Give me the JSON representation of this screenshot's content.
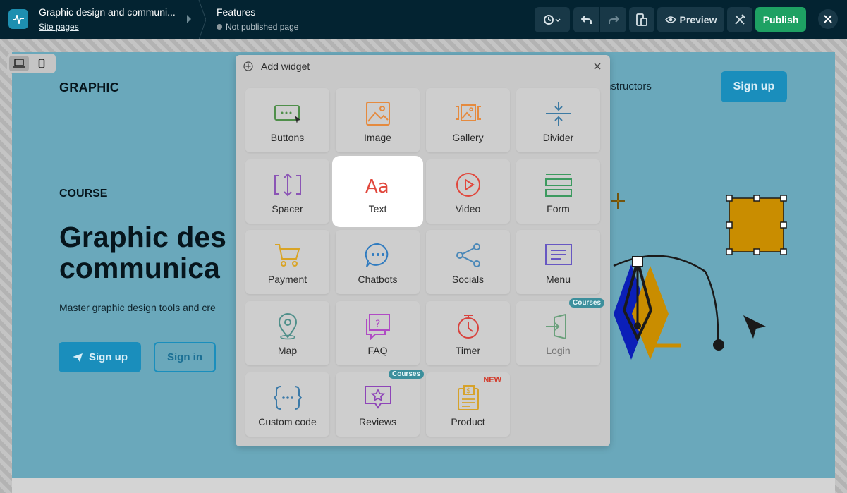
{
  "topbar": {
    "site_title": "Graphic design and communi...",
    "site_pages_link": "Site pages",
    "page_name": "Features",
    "page_status": "Not published page",
    "preview_label": "Preview",
    "publish_label": "Publish"
  },
  "site": {
    "logo_text": "GRAPHIC",
    "nav_item": "nstructors",
    "signup_top_label": "Sign up",
    "course_label": "COURSE",
    "hero_title": "Graphic des\ncommunica",
    "hero_desc": "Master graphic design tools and cre",
    "signup_label": "Sign up",
    "signin_label": "Sign in"
  },
  "panel": {
    "title": "Add widget",
    "tiles": [
      {
        "label": "Buttons",
        "icon": "buttons-icon",
        "color": "#4f8f4a"
      },
      {
        "label": "Image",
        "icon": "image-icon",
        "color": "#e58a3e"
      },
      {
        "label": "Gallery",
        "icon": "gallery-icon",
        "color": "#e58a3e"
      },
      {
        "label": "Divider",
        "icon": "divider-icon",
        "color": "#3d7aa3"
      },
      {
        "label": "Spacer",
        "icon": "spacer-icon",
        "color": "#8b55b5"
      },
      {
        "label": "Text",
        "icon": "text-icon",
        "color": "#e1473c"
      },
      {
        "label": "Video",
        "icon": "video-icon",
        "color": "#e1473c"
      },
      {
        "label": "Form",
        "icon": "form-icon",
        "color": "#3c9a5f"
      },
      {
        "label": "Payment",
        "icon": "cart-icon",
        "color": "#d9a425"
      },
      {
        "label": "Chatbots",
        "icon": "chatbot-icon",
        "color": "#2f7bc0"
      },
      {
        "label": "Socials",
        "icon": "share-icon",
        "color": "#4a88b8"
      },
      {
        "label": "Menu",
        "icon": "menu-icon",
        "color": "#6757c2"
      },
      {
        "label": "Map",
        "icon": "map-pin-icon",
        "color": "#4f8f8a"
      },
      {
        "label": "FAQ",
        "icon": "faq-icon",
        "color": "#b04bc4"
      },
      {
        "label": "Timer",
        "icon": "timer-icon",
        "color": "#d8433e"
      },
      {
        "label": "Login",
        "icon": "login-icon",
        "color": "#6aa07b",
        "badge": "Courses"
      },
      {
        "label": "Custom code",
        "icon": "code-icon",
        "color": "#3c7aa8"
      },
      {
        "label": "Reviews",
        "icon": "reviews-icon",
        "color": "#8e45b8",
        "badge": "Courses"
      },
      {
        "label": "Product",
        "icon": "product-icon",
        "color": "#d6a22a",
        "badge_new": "NEW"
      }
    ]
  }
}
